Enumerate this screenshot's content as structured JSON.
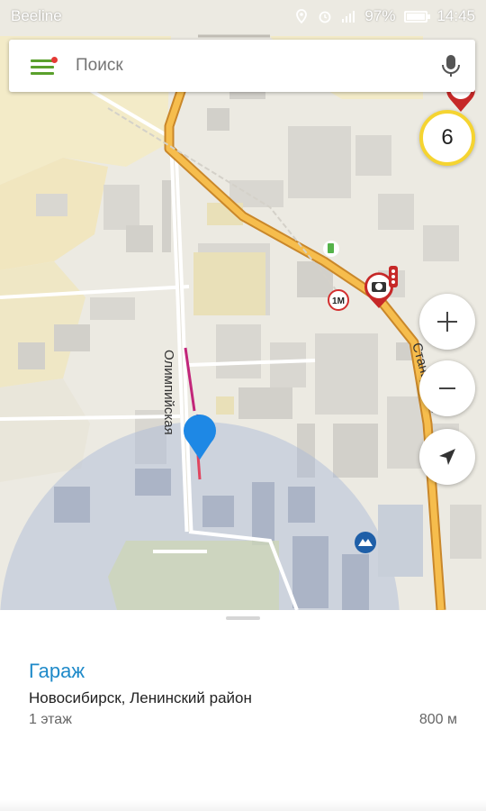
{
  "status_bar": {
    "carrier": "Beeline",
    "battery": "97%",
    "battery_level": 0.97,
    "time": "14:45"
  },
  "search": {
    "placeholder": "Поиск",
    "menu_icon": "hamburger-menu-icon",
    "voice_icon": "microphone-icon"
  },
  "map": {
    "street_labels": [
      "Олимпийская",
      "Станц ... ая"
    ],
    "traffic_level": "6",
    "poi_icons": [
      "fuel-station-icon",
      "metro-icon",
      "speed-camera-icon",
      "traffic-light-icon",
      "shop-icon"
    ],
    "colors": {
      "main_road": "#f2b23a",
      "route": "#c2267a",
      "location_marker": "#1e88e5",
      "accuracy_circle": "#a9b7d6",
      "traffic_badge_border": "#f5d431"
    }
  },
  "controls": {
    "zoom_in_icon": "plus-icon",
    "zoom_out_icon": "minus-icon",
    "locate_icon": "navigation-arrow-icon"
  },
  "place_card": {
    "title": "Гараж",
    "address": "Новосибирск, Ленинский район",
    "floor": "1 этаж",
    "distance": "800 м"
  }
}
